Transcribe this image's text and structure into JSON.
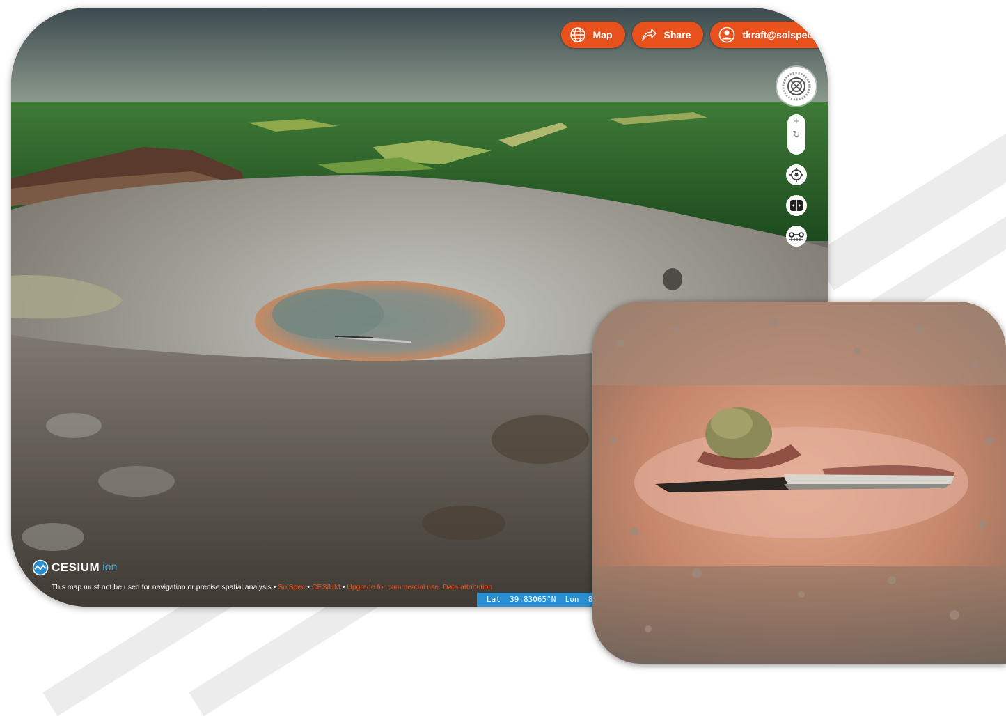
{
  "toolbar": {
    "map_label": "Map",
    "share_label": "Share",
    "user_label": "tkraft@solspec.i"
  },
  "nav": {
    "zoom_in": "+",
    "reset": "↻",
    "zoom_out": "−"
  },
  "cesium": {
    "logo_word": "CESIUM",
    "logo_suffix": "ion"
  },
  "credits": {
    "notice": "This map must not be used for navigation or precise spatial analysis",
    "sep": " • ",
    "links": [
      "SolSpec",
      "CESIUM",
      "Upgrade for commercial use.",
      "Data attribution"
    ]
  },
  "coords": {
    "text": "Lat  39.83065°N  Lon  8"
  },
  "colors": {
    "accent": "#e8501c",
    "coords_bar": "#2a8fd0"
  },
  "icons": [
    "globe-icon",
    "share-icon",
    "user-icon",
    "compass-icon",
    "locate-icon",
    "split-icon",
    "measure-icon",
    "cesium-icon"
  ]
}
